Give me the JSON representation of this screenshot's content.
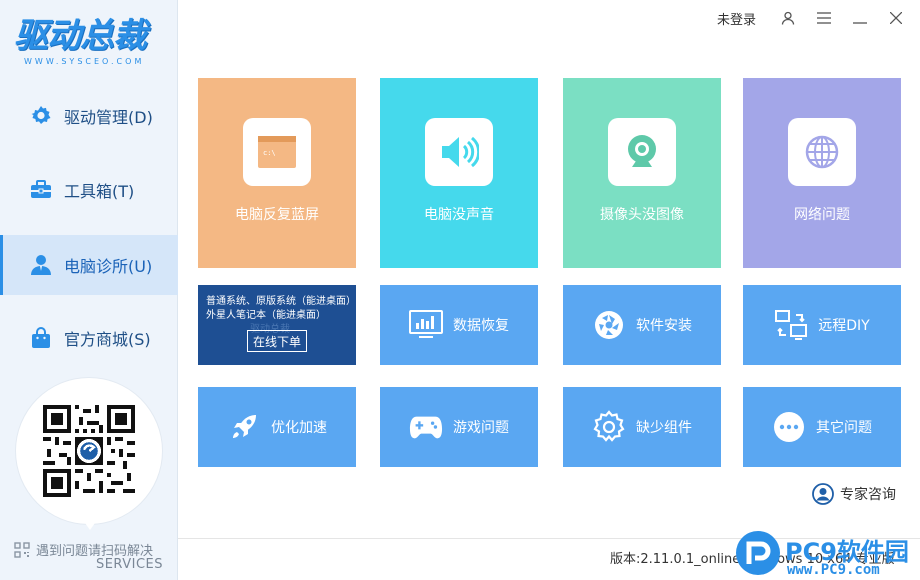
{
  "app": {
    "logo_text": "驱动总裁",
    "logo_sub": "WWW.SYSCEO.COM"
  },
  "sidebar": {
    "items": [
      {
        "label": "驱动管理(D)",
        "icon": "gear-icon"
      },
      {
        "label": "工具箱(T)",
        "icon": "toolbox-icon"
      },
      {
        "label": "电脑诊所(U)",
        "icon": "user-icon",
        "active": true
      },
      {
        "label": "官方商城(S)",
        "icon": "shopping-bag-icon"
      }
    ],
    "qr_caption": "遇到问题请扫码解决",
    "qr_services": "SERVICES"
  },
  "topbar": {
    "login": "未登录"
  },
  "tiles_big": [
    {
      "label": "电脑反复蓝屏",
      "color": "#f4b884",
      "icon": "terminal-window-icon"
    },
    {
      "label": "电脑没声音",
      "color": "#45d9ec",
      "icon": "speaker-icon"
    },
    {
      "label": "摄像头没图像",
      "color": "#7bdfc3",
      "icon": "webcam-icon"
    },
    {
      "label": "网络问题",
      "color": "#a3a6e8",
      "icon": "globe-icon"
    }
  ],
  "ad": {
    "line1": "普通系统、原版系统（能进桌面）",
    "line2": "外星人笔记本（能进桌面）",
    "button": "在线下单",
    "watermark": "驱动总裁"
  },
  "tiles_row2": [
    {
      "label": "数据恢复",
      "icon": "monitor-chart-icon"
    },
    {
      "label": "软件安装",
      "icon": "aperture-icon"
    },
    {
      "label": "远程DIY",
      "icon": "remote-screens-icon"
    }
  ],
  "tiles_row3": [
    {
      "label": "优化加速",
      "icon": "rocket-icon"
    },
    {
      "label": "游戏问题",
      "icon": "gamepad-icon"
    },
    {
      "label": "缺少组件",
      "icon": "cog-icon"
    },
    {
      "label": "其它问题",
      "icon": "more-dots-icon"
    }
  ],
  "colors": {
    "tile_blue": "#5aa7f2",
    "accent": "#2b8fe6"
  },
  "expert": {
    "label": "专家咨询"
  },
  "status": {
    "version": "版本:2.11.0.1_online   Windows 10 x64 专业版"
  },
  "watermark": {
    "title": "PC9软件园",
    "url": "www.PC9.com"
  }
}
